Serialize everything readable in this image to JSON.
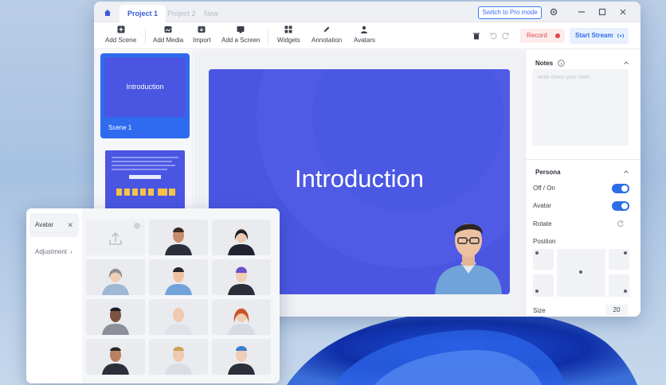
{
  "titlebar": {
    "tabs": [
      {
        "label": "Project 1",
        "active": true
      },
      {
        "label": "Project 2",
        "active": false
      },
      {
        "label": "New",
        "active": false
      }
    ],
    "pro_mode_label": "Switch to Pro mode"
  },
  "toolbar": {
    "items": [
      {
        "label": "Add Scene",
        "icon": "plus-square-icon"
      },
      {
        "label": "Add Media",
        "icon": "image-plus-icon"
      },
      {
        "label": "Import",
        "icon": "import-icon"
      },
      {
        "label": "Add a Screen",
        "icon": "monitor-icon"
      },
      {
        "label": "Widgets",
        "icon": "grid-icon"
      },
      {
        "label": "Annotation",
        "icon": "pen-icon"
      },
      {
        "label": "Avatars",
        "icon": "person-icon"
      }
    ],
    "record_label": "Record",
    "stream_label": "Start Stream"
  },
  "scenes": [
    {
      "title": "Introduction",
      "label": "Scene 1"
    }
  ],
  "slide": {
    "title": "Introduction"
  },
  "props": {
    "notes_header": "Notes",
    "notes_placeholder": "write down your note...",
    "persona_header": "Persona",
    "off_on_label": "Off / On",
    "avatar_label": "Avatar",
    "rotate_label": "Rotate",
    "position_label": "Position",
    "size_label": "Size",
    "size_value": "20"
  },
  "avatar_panel": {
    "tab_label": "Avatar",
    "adjustment_label": "Adjustment"
  },
  "colors": {
    "accent": "#2d6ee8",
    "slide_bg": "#4a56e2",
    "record": "#e34547"
  }
}
